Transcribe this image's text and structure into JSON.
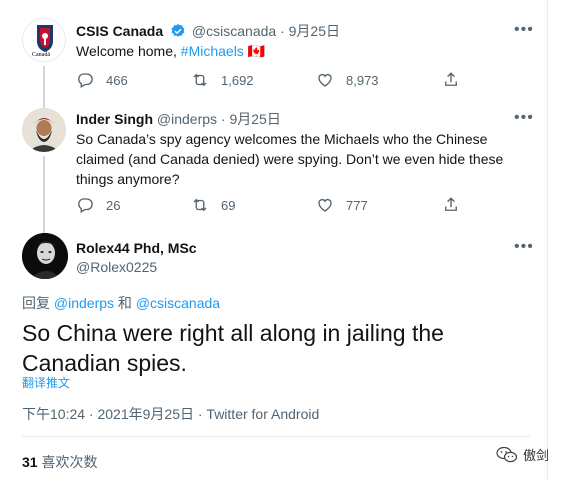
{
  "tweets": [
    {
      "display_name": "CSIS Canada",
      "handle": "@csiscanada",
      "sep": "·",
      "date": "9月25日",
      "text_prefix": "Welcome home, ",
      "hashtag": "#Michaels",
      "flag": "🇨🇦",
      "logo_text": "Canadä",
      "counts": {
        "reply": "466",
        "retweet": "1,692",
        "like": "8,973"
      }
    },
    {
      "display_name": "Inder Singh",
      "handle": "@inderps",
      "sep": "·",
      "date": "9月25日",
      "text": "So Canada’s spy agency welcomes the Michaels who the Chinese claimed (and Canada denied) were spying. Don’t we even hide these things anymore?",
      "counts": {
        "reply": "26",
        "retweet": "69",
        "like": "777"
      }
    }
  ],
  "focus_tweet": {
    "display_name": "Rolex44 Phd, MSc",
    "handle": "@Rolex0225",
    "reply_label": "回复",
    "reply_user1": "@inderps",
    "reply_conj": "和",
    "reply_user2": "@csiscanada",
    "text": "So China were right all along in jailing the Canadian spies.",
    "translate": "翻译推文",
    "timestamp": "下午10:24 · 2021年9月25日 · Twitter for Android",
    "likes_count": "31",
    "likes_label": "喜欢次数"
  },
  "watermark": {
    "text": "傲剑",
    "icon": "wechat-icon"
  },
  "colors": {
    "link": "#1d9bf0",
    "muted": "#536471",
    "verified": "#1d9bf0",
    "text": "#0f1419"
  }
}
